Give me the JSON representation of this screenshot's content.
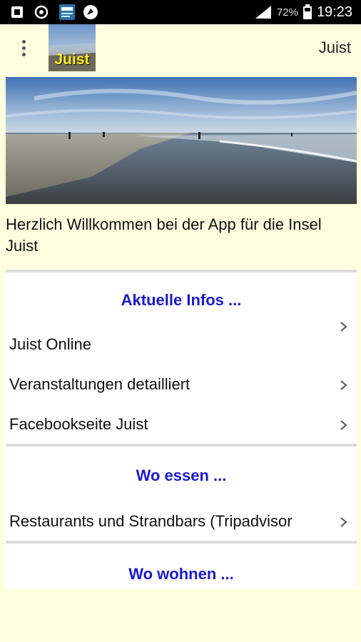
{
  "status_bar": {
    "battery": "72%",
    "time": "19:23"
  },
  "app_bar": {
    "logo_text": "Juist",
    "title": "Juist"
  },
  "welcome_text": "Herzlich Willkommen bei der App für die Insel Juist",
  "sections": [
    {
      "header": "Aktuelle Infos ...",
      "items": [
        "Juist Online",
        "Veranstaltungen detailliert",
        "Facebookseite Juist"
      ]
    },
    {
      "header": "Wo essen ...",
      "items": [
        "Restaurants und Strandbars (Tripadvisor"
      ]
    },
    {
      "header": "Wo wohnen ...",
      "items": []
    }
  ],
  "colors": {
    "background": "#ffffe0",
    "section_header": "#1a1acc"
  }
}
